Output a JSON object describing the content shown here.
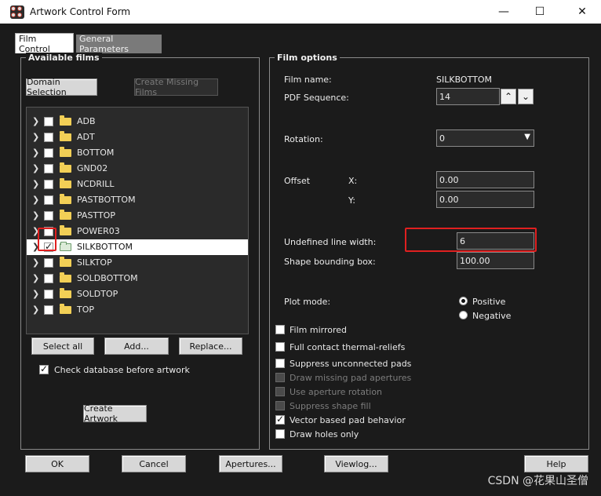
{
  "window": {
    "title": "Artwork Control Form"
  },
  "tabs": [
    {
      "label": "Film Control"
    },
    {
      "label": "General Parameters"
    }
  ],
  "available_films": {
    "title": "Available films",
    "domain_selection": "Domain Selection",
    "create_missing": "Create Missing Films",
    "films": [
      {
        "name": "ADB",
        "checked": false,
        "selected": false
      },
      {
        "name": "ADT",
        "checked": false,
        "selected": false
      },
      {
        "name": "BOTTOM",
        "checked": false,
        "selected": false
      },
      {
        "name": "GND02",
        "checked": false,
        "selected": false
      },
      {
        "name": "NCDRILL",
        "checked": false,
        "selected": false
      },
      {
        "name": "PASTBOTTOM",
        "checked": false,
        "selected": false
      },
      {
        "name": "PASTTOP",
        "checked": false,
        "selected": false
      },
      {
        "name": "POWER03",
        "checked": false,
        "selected": false
      },
      {
        "name": "SILKBOTTOM",
        "checked": true,
        "selected": true
      },
      {
        "name": "SILKTOP",
        "checked": false,
        "selected": false
      },
      {
        "name": "SOLDBOTTOM",
        "checked": false,
        "selected": false
      },
      {
        "name": "SOLDTOP",
        "checked": false,
        "selected": false
      },
      {
        "name": "TOP",
        "checked": false,
        "selected": false
      }
    ],
    "select_all": "Select all",
    "add": "Add...",
    "replace": "Replace...",
    "check_db_label": "Check database before artwork",
    "check_db_checked": true,
    "create_artwork": "Create Artwork"
  },
  "film_options": {
    "title": "Film options",
    "film_name_label": "Film name:",
    "film_name_value": "SILKBOTTOM",
    "pdf_seq_label": "PDF Sequence:",
    "pdf_seq_value": "14",
    "rotation_label": "Rotation:",
    "rotation_value": "0",
    "offset_label": "Offset",
    "x_label": "X:",
    "x_value": "0.00",
    "y_label": "Y:",
    "y_value": "0.00",
    "undef_line_label": "Undefined line width:",
    "undef_line_value": "6",
    "shape_bbox_label": "Shape bounding box:",
    "shape_bbox_value": "100.00",
    "plot_mode_label": "Plot mode:",
    "positive": "Positive",
    "negative": "Negative",
    "plot_mode_selected": "Positive",
    "options": [
      {
        "label": "Film mirrored",
        "checked": false,
        "disabled": false
      },
      {
        "label": "Full contact thermal-reliefs",
        "checked": false,
        "disabled": false
      },
      {
        "label": "Suppress unconnected pads",
        "checked": false,
        "disabled": false
      },
      {
        "label": "Draw missing pad apertures",
        "checked": false,
        "disabled": true
      },
      {
        "label": "Use aperture rotation",
        "checked": false,
        "disabled": true
      },
      {
        "label": "Suppress shape fill",
        "checked": false,
        "disabled": true
      },
      {
        "label": "Vector based pad behavior",
        "checked": true,
        "disabled": false
      },
      {
        "label": "Draw holes only",
        "checked": false,
        "disabled": false
      }
    ]
  },
  "footer": {
    "ok": "OK",
    "cancel": "Cancel",
    "apertures": "Apertures...",
    "viewlog": "Viewlog...",
    "help": "Help"
  },
  "watermark": "CSDN @花果山圣僧"
}
